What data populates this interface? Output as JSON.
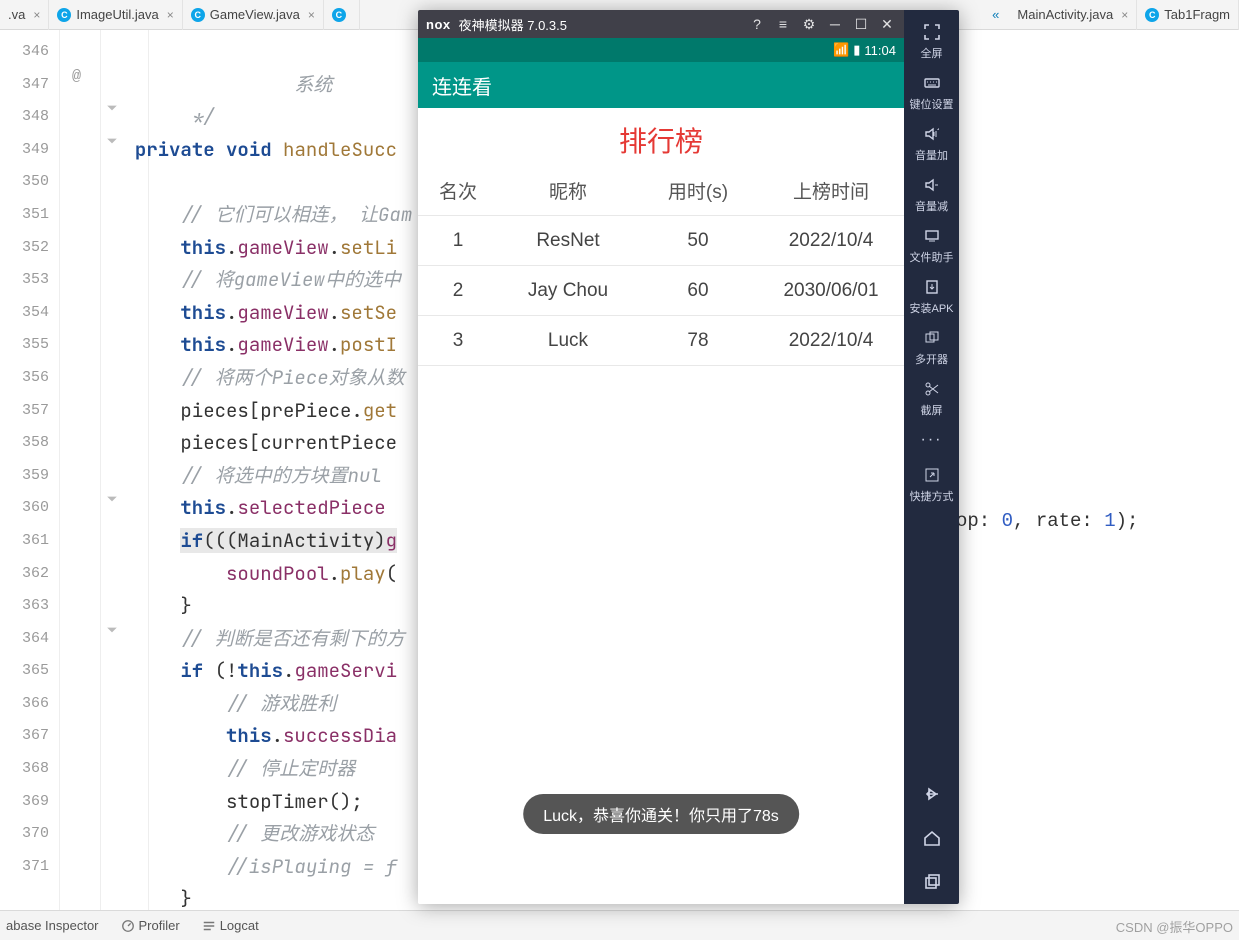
{
  "ide": {
    "tabs": [
      {
        "label": ".va"
      },
      {
        "label": "ImageUtil.java"
      },
      {
        "label": "GameView.java"
      },
      {
        "label": ""
      },
      {
        "label": "MainActivity.java"
      },
      {
        "label": "Tab1Fragm"
      }
    ],
    "bottom": {
      "inspector": "abase Inspector",
      "profiler": "Profiler",
      "logcat": "Logcat"
    }
  },
  "gutter": {
    "at": "@",
    "lines": [
      "",
      "346",
      "347",
      "348",
      "349",
      "350",
      "351",
      "352",
      "353",
      "354",
      "355",
      "356",
      "357",
      "358",
      "359",
      "360",
      "361",
      "362",
      "363",
      "364",
      "365",
      "366",
      "367",
      "368",
      "369",
      "370",
      "371"
    ]
  },
  "code": {
    "l0": "                系统",
    "l1": "       */",
    "l2a": "private",
    "l2b": "void",
    "l2c": "handleSucc",
    "l4": "    // 它们可以相连， 让Gam",
    "l5a": "this",
    "l5b": "gameView",
    "l5c": "setLi",
    "l6": "    // 将gameView中的选中",
    "l7a": "this",
    "l7b": "gameView",
    "l7c": "setSe",
    "l8a": "this",
    "l8b": "gameView",
    "l8c": "postI",
    "l9": "    // 将两个Piece对象从数",
    "l10a": "pieces[prePiece.",
    "l10b": "get",
    "l11": "pieces[currentPiece",
    "l12": "    // 将选中的方块置nul",
    "l13a": "this",
    "l13b": "selectedPiece",
    "l14a": "if",
    "l14b": "(((MainActivity)",
    "l14c": "g",
    "l15a": "soundPool",
    "l15b": "play",
    "l16": "    }",
    "l17": "    // 判断是否还有剩下的方",
    "l18a": "if",
    "l18b": " (!",
    "l18c": "this",
    "l18d": "gameServi",
    "l19": "        // 游戏胜利",
    "l20a": "this",
    "l20b": "successDia",
    "l21": "        // 停止定时器",
    "l22": "stopTimer();",
    "l23": "        // 更改游戏状态",
    "l24": "        //isPlaying = f",
    "l25": "    }",
    "l26": "}",
    "right": {
      "a": "op: ",
      "a_num": "0",
      "b": ",   rate: ",
      "b_num": "1",
      "c": ");"
    }
  },
  "emu": {
    "title_app": "nox",
    "title_text": "夜神模拟器 7.0.3.5",
    "status_time": "11:04",
    "app_title": "连连看",
    "rank_title": "排行榜",
    "headers": {
      "rank": "名次",
      "nick": "昵称",
      "time": "用时(s)",
      "date": "上榜时间"
    },
    "rows": [
      {
        "rank": "1",
        "nick": "ResNet",
        "time": "50",
        "date": "2022/10/4"
      },
      {
        "rank": "2",
        "nick": "Jay Chou",
        "time": "60",
        "date": "2030/06/01"
      },
      {
        "rank": "3",
        "nick": "Luck",
        "time": "78",
        "date": "2022/10/4"
      }
    ],
    "toast": "Luck，恭喜你通关！你只用了78s",
    "sidebar": {
      "fullscreen": "全屏",
      "keys": "键位设置",
      "volup": "音量加",
      "voldown": "音量减",
      "filehelper": "文件助手",
      "installapk": "安装APK",
      "multi": "多开器",
      "screenshot": "截屏",
      "more": "···",
      "shortcut": "快捷方式"
    }
  },
  "watermark": "CSDN @振华OPPO"
}
